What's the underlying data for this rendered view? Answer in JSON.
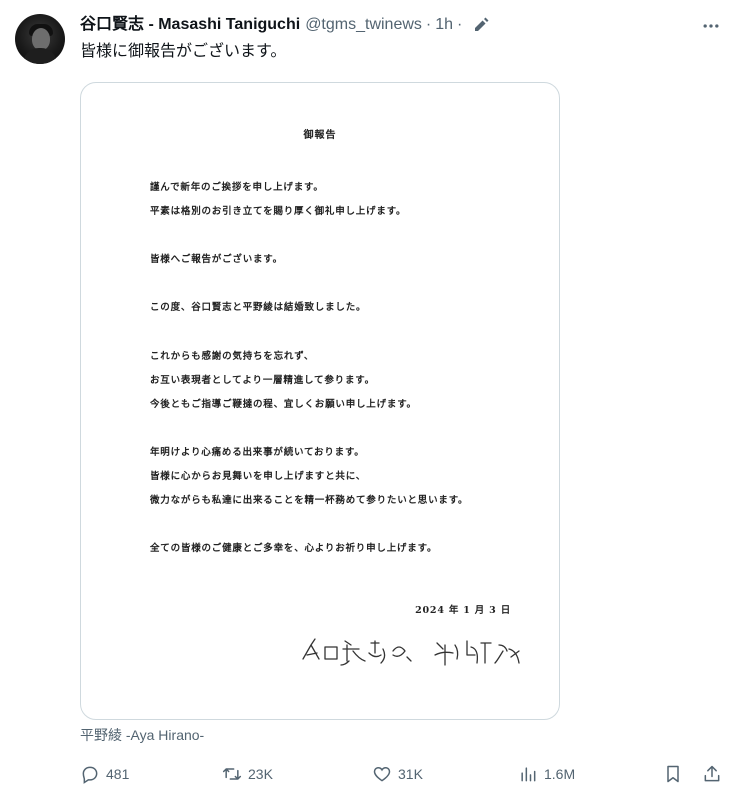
{
  "author": {
    "name": "谷口賢志 - Masashi Taniguchi",
    "handle": "@tgms_twinews",
    "separator": "·",
    "time": "1h",
    "separator2": "·"
  },
  "tweet": {
    "text": "皆様に御報告がございます。"
  },
  "image_doc": {
    "title": "御報告",
    "lines": [
      "謹んで新年のご挨拶を申し上げます。",
      "平素は格別のお引き立てを賜り厚く御礼申し上げます。",
      "皆様へご報告がございます。",
      "この度、谷口賢志と平野綾は結婚致しました。",
      "これからも感謝の気持ちを忘れず、",
      "お互い表現者としてより一層精進して参ります。",
      "今後ともご指導ご鞭撻の程、宜しくお願い申し上げます。",
      "年明けより心痛める出来事が続いております。",
      "皆様に心からお見舞いを申し上げますと共に、",
      "微力ながらも私達に出来ることを精一杯務めて参りたいと思います。",
      "全ての皆様のご健康とご多幸を、心よりお祈り申し上げます。"
    ],
    "date": "2024 年 1 月 3 日",
    "signature": "谷口賢志 平野綾"
  },
  "caption": "平野綾 -Aya Hirano-",
  "actions": {
    "replies": "481",
    "reposts": "23K",
    "likes": "31K",
    "views": "1.6M"
  },
  "icons": {
    "edit": "edit-icon",
    "more": "more-icon",
    "reply": "reply-icon",
    "repost": "repost-icon",
    "like": "heart-icon",
    "views": "views-icon",
    "bookmark": "bookmark-icon",
    "share": "share-icon"
  }
}
